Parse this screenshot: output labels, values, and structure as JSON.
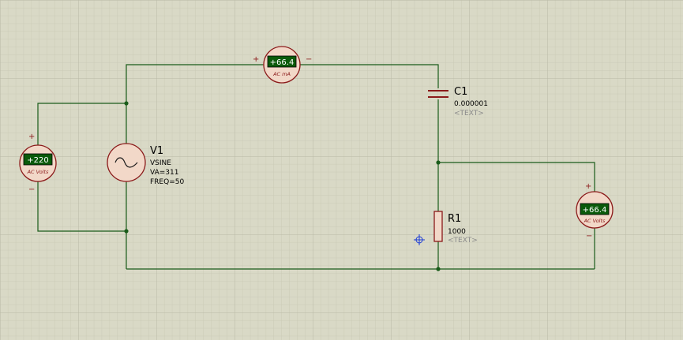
{
  "components": {
    "v1": {
      "ref": "V1",
      "type": "VSINE",
      "amplitude": "VA=311",
      "frequency": "FREQ=50"
    },
    "c1": {
      "ref": "C1",
      "value": "0.000001",
      "text": "<TEXT>"
    },
    "r1": {
      "ref": "R1",
      "value": "1000",
      "text": "<TEXT>"
    }
  },
  "meters": {
    "left_voltmeter": {
      "reading": "+220",
      "unit": "AC Volts",
      "plus": "+",
      "minus": "−"
    },
    "ammeter": {
      "reading": "+66.4",
      "unit": "AC mA",
      "plus": "+",
      "minus": "−"
    },
    "right_voltmeter": {
      "reading": "+66.4",
      "unit": "AC Volts",
      "plus": "+",
      "minus": "−"
    }
  },
  "colors": {
    "background": "#d9d9c6",
    "grid_minor": "#c8c8b4",
    "grid_major": "#b9b9a5",
    "wire": "#1a5c1a",
    "component_outline": "#8b1a1a",
    "meter_fill": "#f2d8c8",
    "display_bg": "#0b5a0b",
    "display_text": "#ffffff",
    "label_text": "#000000",
    "hint_text": "#8a8a8a",
    "cursor": "#1a3ad6"
  }
}
